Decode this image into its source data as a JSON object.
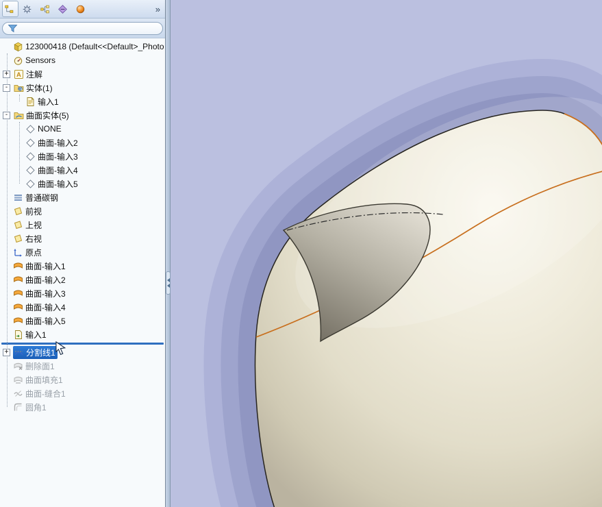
{
  "colors": {
    "selection": "#2e7bd6",
    "rollback": "#2f6fc0",
    "viewport_background": "#bbc0e0",
    "model_body": "#efebdb",
    "model_edge": "#26241f",
    "feature_curve": "#c86f1e"
  },
  "panel": {
    "toolbar": {
      "tabs": [
        {
          "name": "feature-manager-tab",
          "icon": "feature-manager-icon"
        },
        {
          "name": "property-manager-tab",
          "icon": "property-manager-icon"
        },
        {
          "name": "configuration-manager-tab",
          "icon": "configuration-manager-icon"
        },
        {
          "name": "dimxpert-manager-tab",
          "icon": "dimxpert-manager-icon"
        },
        {
          "name": "display-manager-tab",
          "icon": "display-manager-icon"
        }
      ],
      "overflow_label": "»"
    },
    "filter": {
      "value": ""
    },
    "tree": {
      "items": [
        {
          "name": "tree-item-root",
          "label": "123000418 (Default<<Default>_Photo",
          "icon": "part-icon",
          "indent": 0
        },
        {
          "name": "tree-item-sensors",
          "label": "Sensors",
          "icon": "sensors-icon",
          "indent": 1
        },
        {
          "name": "tree-item-annotations",
          "label": "注解",
          "icon": "annotations-icon",
          "indent": 1,
          "expander": "plus"
        },
        {
          "name": "tree-item-solid-bodies",
          "label": "实体(1)",
          "icon": "solid-bodies-icon",
          "indent": 1,
          "expander": "minus"
        },
        {
          "name": "tree-item-solid-import1",
          "label": "输入1",
          "icon": "import-doc-icon",
          "indent": 2
        },
        {
          "name": "tree-item-surface-bodies",
          "label": "曲面实体(5)",
          "icon": "surface-bodies-icon",
          "indent": 1,
          "expander": "minus"
        },
        {
          "name": "tree-item-surface-body-none",
          "label": "NONE",
          "icon": "surface-body-icon",
          "indent": 2
        },
        {
          "name": "tree-item-surface-body-import2",
          "label": "曲面-输入2",
          "icon": "surface-body-icon",
          "indent": 2
        },
        {
          "name": "tree-item-surface-body-import3",
          "label": "曲面-输入3",
          "icon": "surface-body-icon",
          "indent": 2
        },
        {
          "name": "tree-item-surface-body-import4",
          "label": "曲面-输入4",
          "icon": "surface-body-icon",
          "indent": 2
        },
        {
          "name": "tree-item-surface-body-import5",
          "label": "曲面-输入5",
          "icon": "surface-body-icon",
          "indent": 2
        },
        {
          "name": "tree-item-material",
          "label": "普通碳钢",
          "icon": "material-icon",
          "indent": 1
        },
        {
          "name": "tree-item-front-plane",
          "label": "前视",
          "icon": "plane-icon",
          "indent": 1
        },
        {
          "name": "tree-item-top-plane",
          "label": "上视",
          "icon": "plane-icon",
          "indent": 1
        },
        {
          "name": "tree-item-right-plane",
          "label": "右视",
          "icon": "plane-icon",
          "indent": 1
        },
        {
          "name": "tree-item-origin",
          "label": "原点",
          "icon": "origin-icon",
          "indent": 1
        },
        {
          "name": "tree-item-surface-import1",
          "label": "曲面-输入1",
          "icon": "surface-feature-icon",
          "indent": 1
        },
        {
          "name": "tree-item-surface-import2",
          "label": "曲面-输入2",
          "icon": "surface-feature-icon",
          "indent": 1
        },
        {
          "name": "tree-item-surface-import3",
          "label": "曲面-输入3",
          "icon": "surface-feature-icon",
          "indent": 1
        },
        {
          "name": "tree-item-surface-import4",
          "label": "曲面-输入4",
          "icon": "surface-feature-icon",
          "indent": 1
        },
        {
          "name": "tree-item-surface-import5",
          "label": "曲面-输入5",
          "icon": "surface-feature-icon",
          "indent": 1
        },
        {
          "name": "tree-item-import1",
          "label": "输入1",
          "icon": "imported-feature-icon",
          "indent": 1
        },
        {
          "type": "rollback",
          "name": "rollback-bar"
        },
        {
          "name": "tree-item-splitline1",
          "label": "分割线1",
          "icon": "splitline-icon",
          "indent": 1,
          "expander": "plus",
          "state": "selected"
        },
        {
          "name": "tree-item-deleteface1",
          "label": "删除面1",
          "icon": "delete-face-icon",
          "indent": 1,
          "state": "disabled"
        },
        {
          "name": "tree-item-surfacefill1",
          "label": "曲面填充1",
          "icon": "surface-fill-icon",
          "indent": 1,
          "state": "disabled"
        },
        {
          "name": "tree-item-knit1",
          "label": "曲面-缝合1",
          "icon": "knit-icon",
          "indent": 1,
          "state": "disabled"
        },
        {
          "name": "tree-item-fillet1",
          "label": "圆角1",
          "icon": "fillet-icon",
          "indent": 1,
          "state": "disabled"
        }
      ]
    }
  }
}
